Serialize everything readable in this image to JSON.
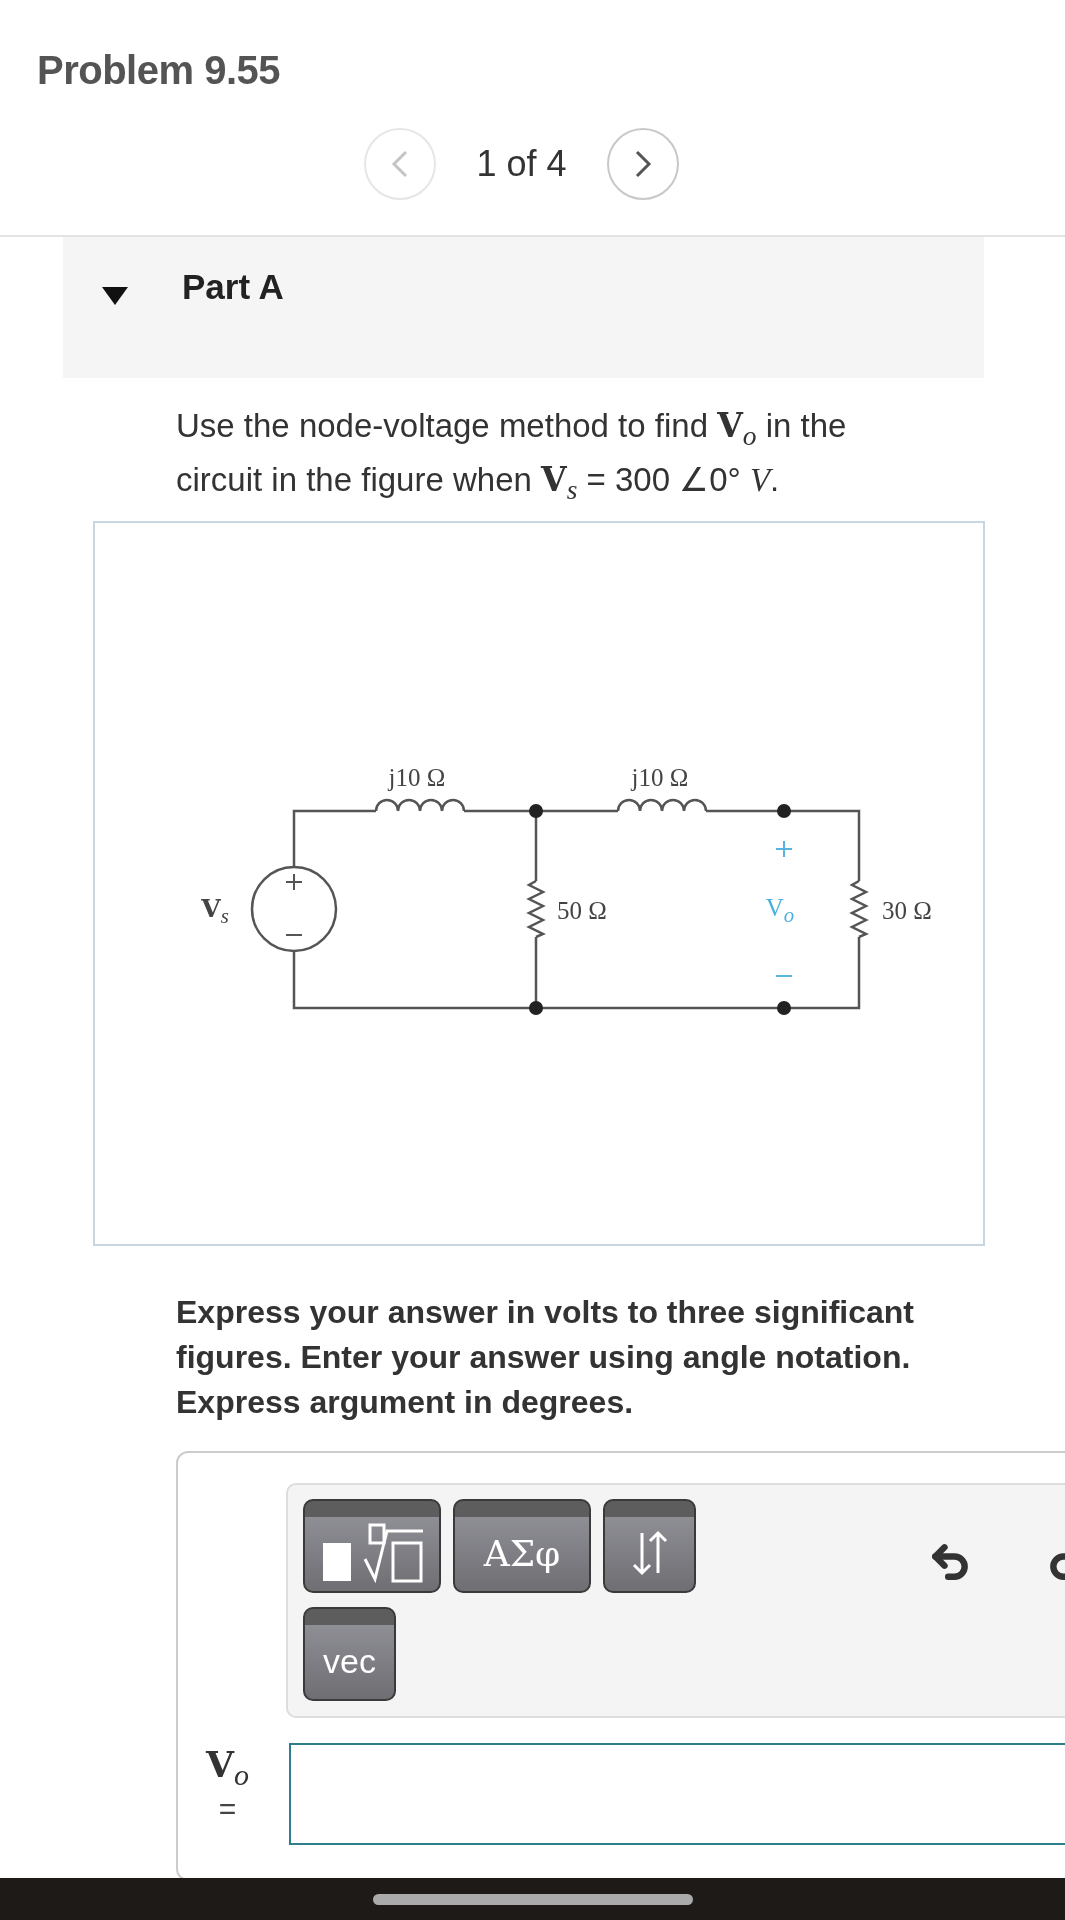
{
  "title": "Problem 9.55",
  "pager": {
    "previous_disabled": true,
    "position": "1 of 4",
    "next_disabled": false
  },
  "part": {
    "label": "Part A",
    "expanded": true
  },
  "problem_text": "Use the node-voltage method to find **V**$_{o}$ in the circuit in the figure when **V**$_{s}$ = 300 ∠0° *V*.",
  "figure": {
    "inductor_1_label": "j10 Ω",
    "inductor_2_label": "j10 Ω",
    "resistor_1_label": "50 Ω",
    "resistor_2_label": "30 Ω",
    "source_label": "**V**$_{s}$",
    "output_label": "V$_{o}$"
  },
  "instructions": "Express your answer in volts to three significant figures. Enter your answer using angle notation. Express argument in degrees.",
  "answer": {
    "toolbar": [
      {
        "kind": "templates"
      },
      {
        "kind": "text",
        "label": "ΑΣφ"
      },
      {
        "kind": "arrows"
      },
      {
        "kind": "text",
        "label": "vec"
      }
    ],
    "variable": "**V**$_{o}$",
    "equals": "="
  },
  "home_indicator": true
}
